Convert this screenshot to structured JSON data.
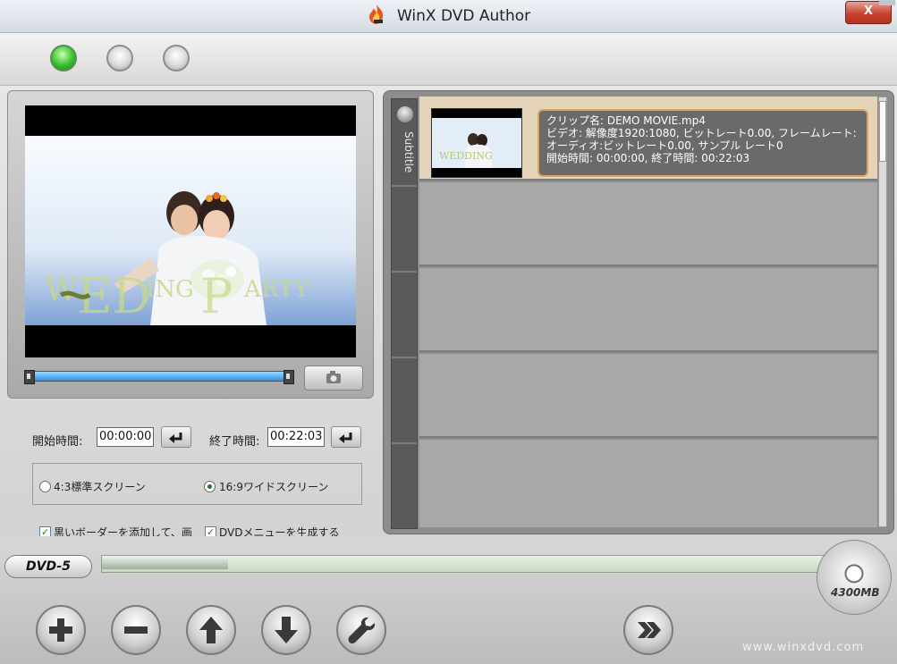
{
  "window": {
    "title": "WinX DVD Author",
    "close_label": "X"
  },
  "steps": [
    {
      "state": "active"
    },
    {
      "state": "inactive"
    },
    {
      "state": "inactive"
    }
  ],
  "preview": {
    "overlay_text": "WEDDING PARTY"
  },
  "trim": {
    "start_label": "開始時間:",
    "start_value": "00:00:00",
    "end_label": "終了時間:",
    "end_value": "00:22:03"
  },
  "aspect": {
    "option_43": "4:3標準スクリーン",
    "option_169": "16:9ワイドスクリーン",
    "selected": "16:9ワイドスクリーン"
  },
  "options": {
    "black_border_label": "黒いボーダーを添加して、画",
    "black_border_checked": true,
    "dvd_menu_label": "DVDメニューを生成する",
    "dvd_menu_checked": true
  },
  "clips": {
    "side_label": "Subtitle",
    "items": [
      {
        "name_line": "クリップ名:  DEMO MOVIE.mp4",
        "video_line": "ビデオ:  解像度1920:1080, ビットレート0.00, フレームレート:",
        "audio_line": "オーディオ:ビットレート0.00, サンプル  レート0",
        "time_line": "開始時間:  00:00:00, 終了時間:  00:22:03"
      }
    ]
  },
  "disc": {
    "type_label": "DVD-5",
    "capacity_label": "4300MB",
    "used_fraction": 0.17
  },
  "toolbar": {
    "buttons": [
      "add",
      "remove",
      "move-up",
      "move-down",
      "settings",
      "next"
    ]
  },
  "watermark": "www.winxdvd.com",
  "colors": {
    "accent_green": "#37c02a",
    "slider_blue": "#2c93e6",
    "selected_row": "#e2d3b9",
    "info_border": "#e0a55c"
  }
}
